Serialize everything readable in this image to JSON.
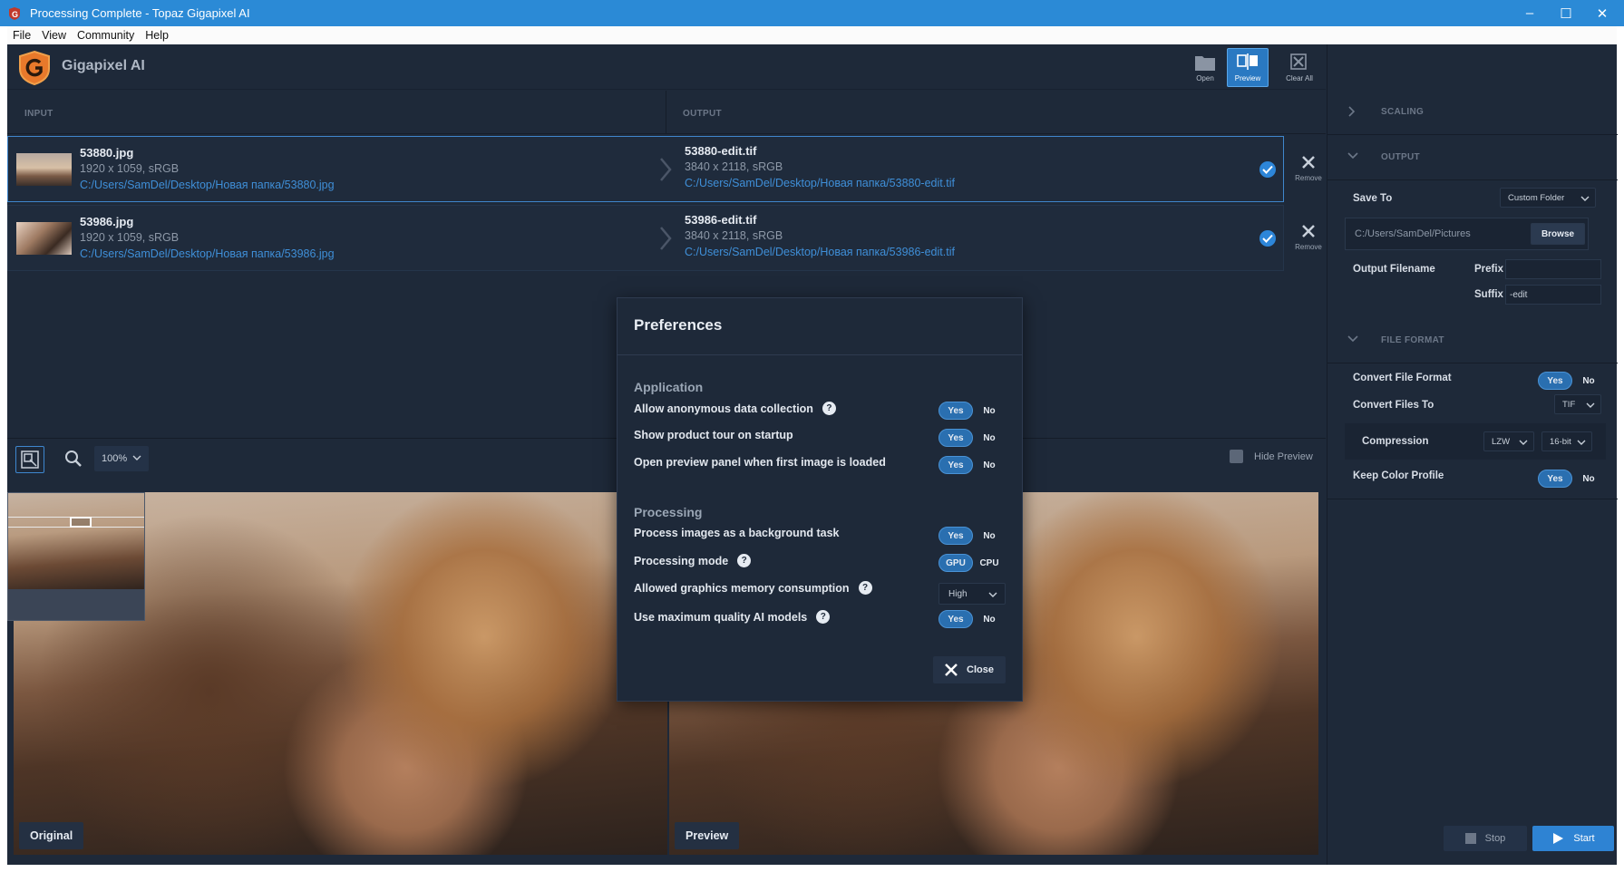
{
  "window": {
    "title": "Processing Complete - Topaz Gigapixel AI",
    "minimize": "–",
    "maximize": "☐",
    "close": "✕"
  },
  "menu": [
    "File",
    "View",
    "Community",
    "Help"
  ],
  "brand": "Gigapixel AI",
  "toolbar": {
    "open": "Open",
    "preview": "Preview",
    "clear_all": "Clear All"
  },
  "list": {
    "input_header": "INPUT",
    "output_header": "OUTPUT",
    "remove_label": "Remove",
    "files": [
      {
        "in_name": "53880.jpg",
        "in_meta": "1920 x 1059, sRGB",
        "in_path": "C:/Users/SamDel/Desktop/Новая папка/53880.jpg",
        "out_name": "53880-edit.tif",
        "out_meta": "3840 x 2118, sRGB",
        "out_path": "C:/Users/SamDel/Desktop/Новая папка/53880-edit.tif"
      },
      {
        "in_name": "53986.jpg",
        "in_meta": "1920 x 1059, sRGB",
        "in_path": "C:/Users/SamDel/Desktop/Новая папка/53986.jpg",
        "out_name": "53986-edit.tif",
        "out_meta": "3840 x 2118, sRGB",
        "out_path": "C:/Users/SamDel/Desktop/Новая папка/53986-edit.tif"
      }
    ]
  },
  "preview": {
    "zoom": "100%",
    "hide_preview": "Hide Preview",
    "original_label": "Original",
    "preview_label": "Preview"
  },
  "panel": {
    "scaling": "SCALING",
    "output": "OUTPUT",
    "save_to_label": "Save To",
    "save_to_value": "Custom Folder",
    "folder_path": "C:/Users/SamDel/Pictures",
    "browse": "Browse",
    "output_filename": "Output Filename",
    "prefix_label": "Prefix",
    "prefix_value": "",
    "suffix_label": "Suffix",
    "suffix_value": "-edit",
    "file_format": "FILE FORMAT",
    "convert_format_label": "Convert File Format",
    "convert_to_label": "Convert Files To",
    "convert_to_value": "TIF",
    "compression_label": "Compression",
    "compression_value": "LZW",
    "bitdepth_value": "16-bit",
    "keep_color_label": "Keep Color Profile",
    "yes": "Yes",
    "no": "No",
    "stop": "Stop",
    "start": "Start"
  },
  "dialog": {
    "title": "Preferences",
    "application_group": "Application",
    "processing_group": "Processing",
    "rows": {
      "anon_data": "Allow anonymous data collection",
      "product_tour": "Show product tour on startup",
      "open_preview": "Open preview panel when first image is loaded",
      "background_task": "Process images as a background task",
      "processing_mode": "Processing mode",
      "memory": "Allowed graphics memory consumption",
      "max_quality": "Use maximum quality AI models"
    },
    "yes": "Yes",
    "no": "No",
    "gpu": "GPU",
    "cpu": "CPU",
    "memory_value": "High",
    "help": "?",
    "close": "Close"
  },
  "colors": {
    "accent": "#2d86d9",
    "bg": "#1e2939",
    "titlebar": "#2b8ad6"
  }
}
